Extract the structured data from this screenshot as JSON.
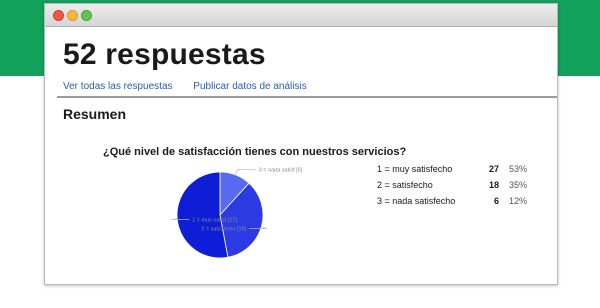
{
  "page": {
    "title": "52 respuestas",
    "links": [
      "Ver todas las respuestas",
      "Publicar datos de análisis"
    ],
    "section": "Resumen"
  },
  "question": "¿Qué nivel de satisfacción tienes con nuestros servicios?",
  "colors": {
    "background_band": "#12a05a",
    "link": "#2a5db0",
    "slice_1": "#0e1ed6",
    "slice_2": "#2b3ae2",
    "slice_3": "#5a6af0"
  },
  "chart_data": {
    "type": "pie",
    "labels": [
      "1 = muy satisf [27]",
      "2 = satisfecho [18]",
      "3 = nada satisf [6]"
    ],
    "categories": [
      "1 = muy satisfecho",
      "2 = satisfecho",
      "3 = nada satisfecho"
    ],
    "values": [
      27,
      18,
      6
    ],
    "percentages": [
      "53%",
      "35%",
      "12%"
    ]
  }
}
